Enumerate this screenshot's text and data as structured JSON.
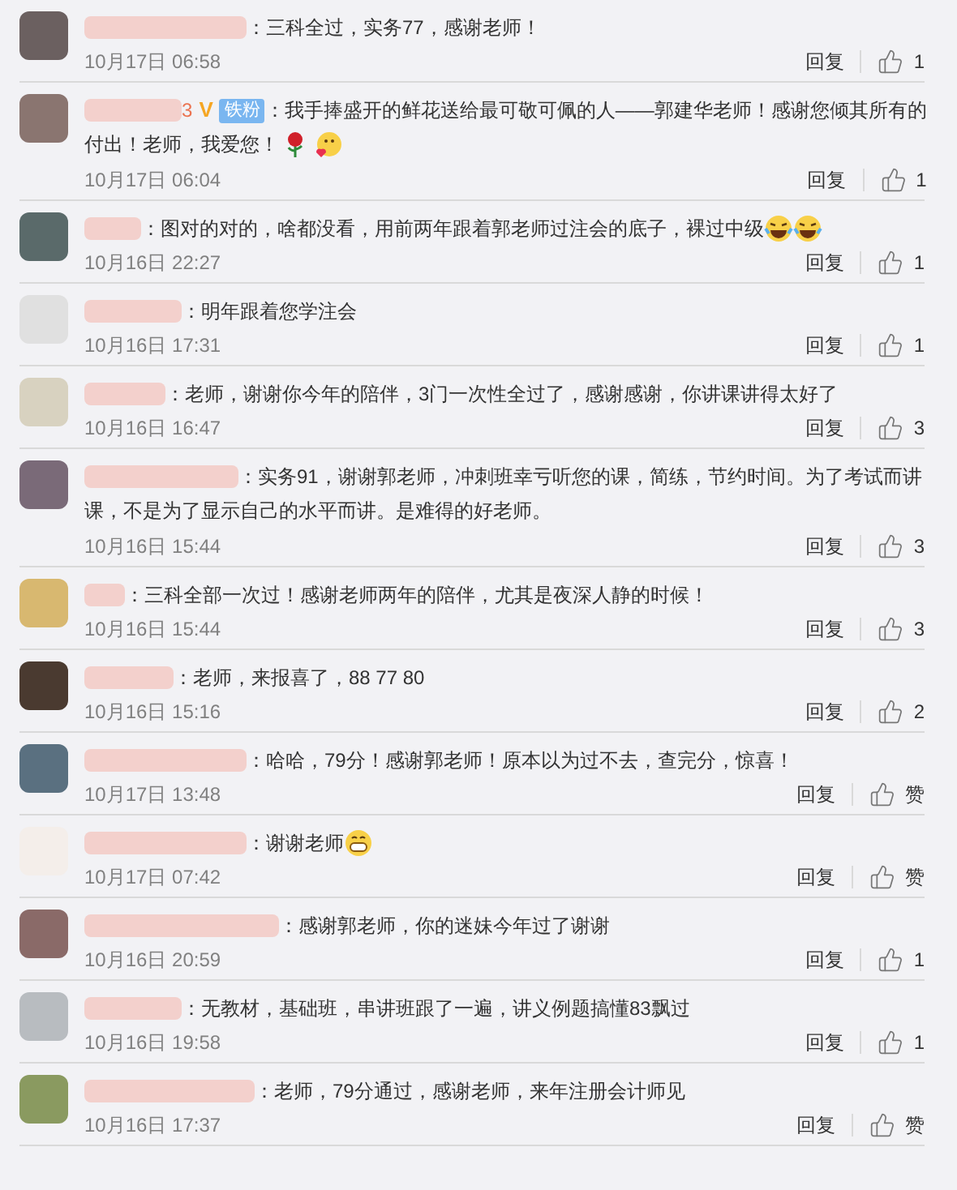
{
  "comments": [
    {
      "text": "：三科全过，实务77，感谢老师！",
      "time": "10月17日 06:58",
      "reply": "回复",
      "likes": "1"
    },
    {
      "name_suffix": "3",
      "badges": [
        {
          "kind": "verified",
          "label": "V"
        },
        {
          "kind": "fan",
          "label": "铁粉"
        }
      ],
      "text": "：我手捧盛开的鲜花送给最可敬可佩的人——郭建华老师！感谢您倾其所有的",
      "text_continued": "付出！老师，我爱您！",
      "emojis": [
        {
          "kind": "rose"
        },
        {
          "kind": "blush"
        }
      ],
      "time": "10月17日 06:04",
      "reply": "回复",
      "likes": "1"
    },
    {
      "text": "：图对的对的，啥都没看，用前两年跟着郭老师过注会的底子，裸过中级",
      "emojis": [
        {
          "kind": "laugh"
        },
        {
          "kind": "laugh"
        }
      ],
      "time": "10月16日 22:27",
      "reply": "回复",
      "likes": "1"
    },
    {
      "text": "：明年跟着您学注会",
      "time": "10月16日 17:31",
      "reply": "回复",
      "likes": "1"
    },
    {
      "text": "：老师，谢谢你今年的陪伴，3门一次性全过了，感谢感谢，你讲课讲得太好了",
      "time": "10月16日 16:47",
      "reply": "回复",
      "likes": "3"
    },
    {
      "text": "：实务91，谢谢郭老师，冲刺班幸亏听您的课，简练，节约时间。为了考试而讲",
      "text_continued": "课，不是为了显示自己的水平而讲。是难得的好老师。",
      "time": "10月16日 15:44",
      "reply": "回复",
      "likes": "3"
    },
    {
      "text": "：三科全部一次过！感谢老师两年的陪伴，尤其是夜深人静的时候！",
      "time": "10月16日 15:44",
      "reply": "回复",
      "likes": "3"
    },
    {
      "text": "：老师，来报喜了，88 77 80",
      "time": "10月16日 15:16",
      "reply": "回复",
      "likes": "2"
    },
    {
      "text": "：哈哈，79分！感谢郭老师！原本以为过不去，查完分，惊喜！",
      "time": "10月17日 13:48",
      "reply": "回复",
      "likes": "赞"
    },
    {
      "text": "：谢谢老师",
      "emojis": [
        {
          "kind": "grin"
        }
      ],
      "time": "10月17日 07:42",
      "reply": "回复",
      "likes": "赞"
    },
    {
      "text": "：感谢郭老师，你的迷妹今年过了谢谢",
      "time": "10月16日 20:59",
      "reply": "回复",
      "likes": "1"
    },
    {
      "text": "：无教材，基础班，串讲班跟了一遍，讲义例题搞懂83飘过",
      "time": "10月16日 19:58",
      "reply": "回复",
      "likes": "1"
    },
    {
      "text": "：老师，79分通过，感谢老师，来年注册会计师见",
      "time": "10月16日 17:37",
      "reply": "回复",
      "likes": "赞"
    }
  ]
}
